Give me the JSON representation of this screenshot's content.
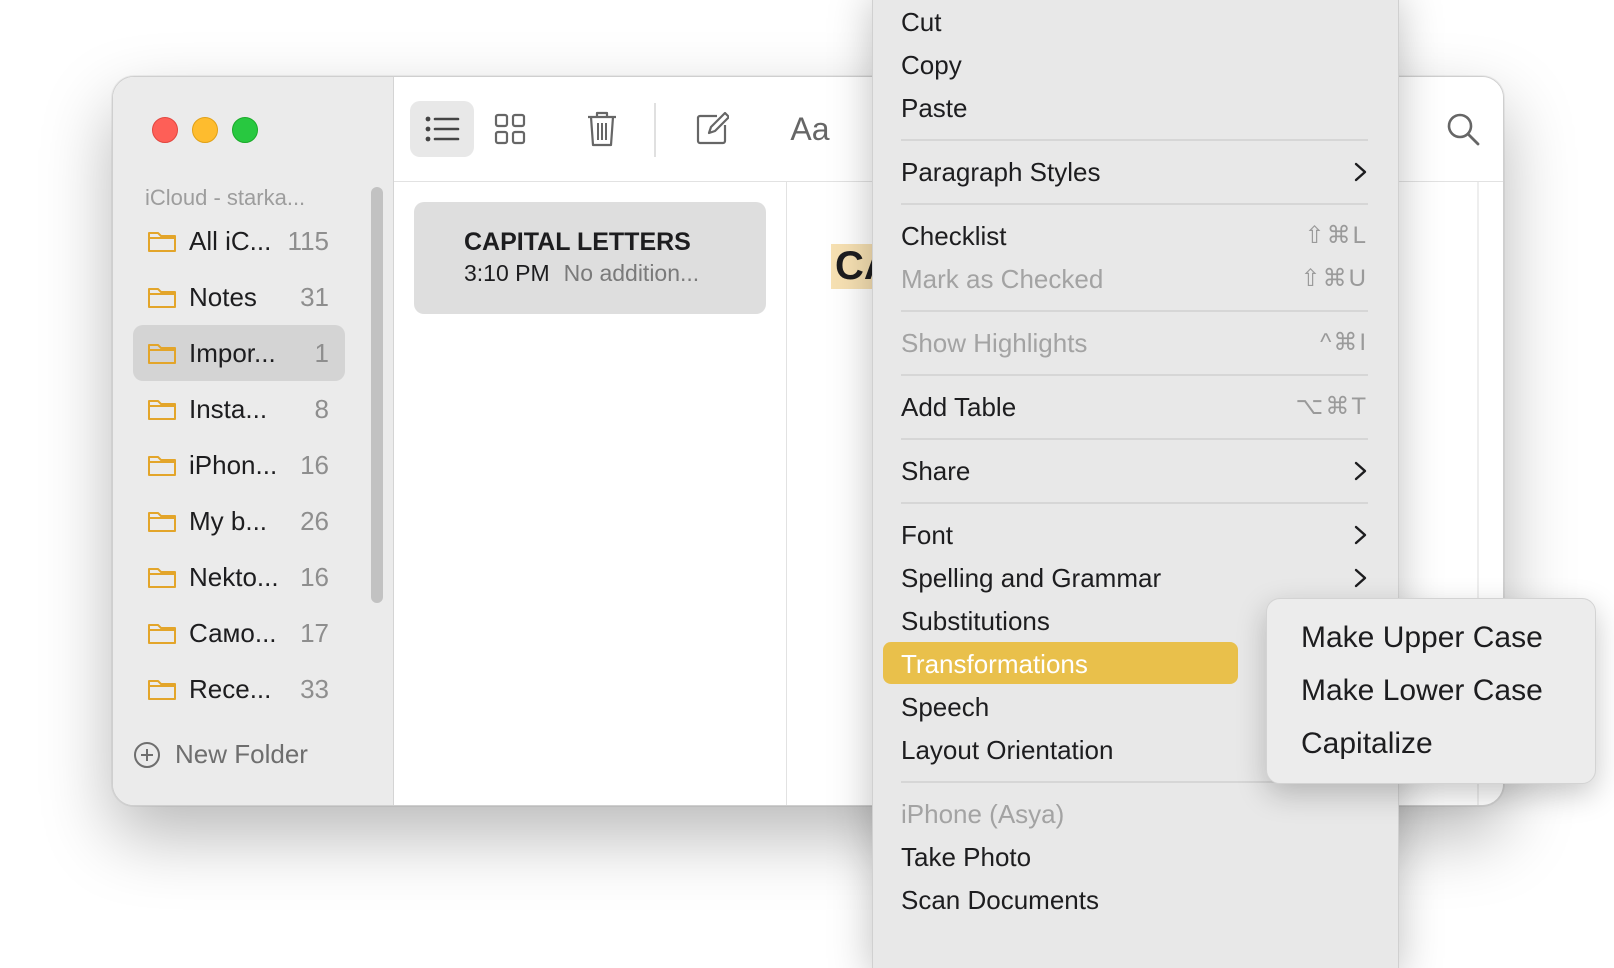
{
  "sidebar": {
    "account": "iCloud - starka...",
    "folders": [
      {
        "name": "All iC...",
        "count": "115"
      },
      {
        "name": "Notes",
        "count": "31"
      },
      {
        "name": "Impor...",
        "count": "1"
      },
      {
        "name": "Insta...",
        "count": "8"
      },
      {
        "name": "iPhon...",
        "count": "16"
      },
      {
        "name": "My b...",
        "count": "26"
      },
      {
        "name": "Nekto...",
        "count": "16"
      },
      {
        "name": "Само...",
        "count": "17"
      },
      {
        "name": "Rece...",
        "count": "33"
      }
    ],
    "selected_folder_index": 2,
    "new_folder_label": "New Folder"
  },
  "toolbar": {
    "format_label": "Aa"
  },
  "note_list": {
    "notes": [
      {
        "title": "CAPITAL LETTERS",
        "time": "3:10 PM",
        "preview": "No addition..."
      }
    ]
  },
  "editor": {
    "visible_text": "CA"
  },
  "context_menu": {
    "items": [
      {
        "label": "Cut"
      },
      {
        "label": "Copy"
      },
      {
        "label": "Paste"
      },
      {
        "label": "Paragraph Styles"
      },
      {
        "label": "Checklist",
        "shortcut": "⇧⌘L"
      },
      {
        "label": "Mark as Checked",
        "shortcut": "⇧⌘U"
      },
      {
        "label": "Show Highlights",
        "shortcut": "^⌘I"
      },
      {
        "label": "Add Table",
        "shortcut": "⌥⌘T"
      },
      {
        "label": "Share"
      },
      {
        "label": "Font"
      },
      {
        "label": "Spelling and Grammar"
      },
      {
        "label": "Substitutions"
      },
      {
        "label": "Transformations"
      },
      {
        "label": "Speech"
      },
      {
        "label": "Layout Orientation"
      },
      {
        "label": "iPhone (Asya)"
      },
      {
        "label": "Take Photo"
      },
      {
        "label": "Scan Documents"
      }
    ]
  },
  "submenu": {
    "items": [
      {
        "label": "Make Upper Case"
      },
      {
        "label": "Make Lower Case"
      },
      {
        "label": "Capitalize"
      }
    ]
  },
  "colors": {
    "highlight": "#e9c04b",
    "folder_icon": "#e3a52a",
    "selection_text_bg": "#f7e1b3"
  }
}
